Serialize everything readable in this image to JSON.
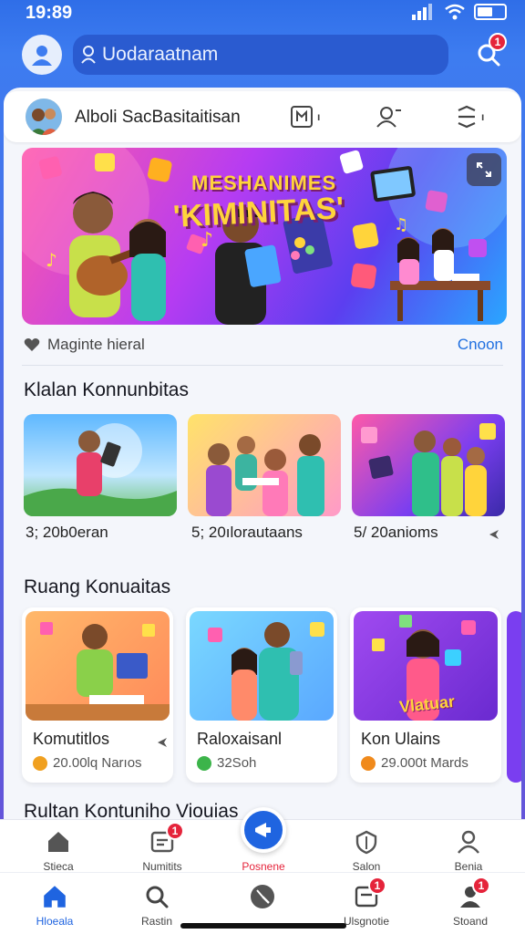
{
  "status": {
    "time": "19:89"
  },
  "top_bar": {
    "search_text": "Uodaraatnam",
    "notification_count": "1"
  },
  "profile": {
    "name": "Alboli SacBasitaitisan",
    "icon1_label": "ı",
    "icon3_label": "ı"
  },
  "banner": {
    "title_line1": "MESHANIMES",
    "title_line2": "'KIMINITAS'"
  },
  "meta": {
    "left_text": "Maginte hieral",
    "right_link": "Cnoon"
  },
  "events_section": {
    "title": "Klalan Konnunbitas",
    "items": [
      {
        "caption": "3; 20b0eran"
      },
      {
        "caption": "5; 20ılorautaans"
      },
      {
        "caption": "5/ 20anioms"
      }
    ]
  },
  "rooms_section": {
    "title": "Ruang Konuaitas",
    "items": [
      {
        "name": "Komutitlos",
        "count": "20.00lq Narıos",
        "dot_color": "#f0a020"
      },
      {
        "name": "Raloxaisanl",
        "count": "32Soh",
        "dot_color": "#3cb44a"
      },
      {
        "name": "Kon Ulains",
        "count": "29.000t Mards",
        "dot_color": "#f08a1c"
      }
    ],
    "card3_overlay": "Vlatuar"
  },
  "next_section_title": "Rultan Kontuniho Viouias",
  "nav_top": {
    "items": [
      {
        "label": "Stieca"
      },
      {
        "label": "Numitits",
        "badge": "1"
      },
      {
        "label": "Posnene",
        "badge": ""
      },
      {
        "label": "Salon"
      },
      {
        "label": "Benia"
      }
    ]
  },
  "nav_bottom": {
    "items": [
      {
        "label": "Hloeala"
      },
      {
        "label": "Rastin"
      },
      {
        "label": ""
      },
      {
        "label": "Ulsgnotie",
        "badge": "1"
      },
      {
        "label": "Stoand",
        "badge": "1"
      }
    ]
  },
  "colors": {
    "primary": "#1f64e0",
    "accent_link": "#1f6fe0",
    "badge": "#e5243b"
  }
}
